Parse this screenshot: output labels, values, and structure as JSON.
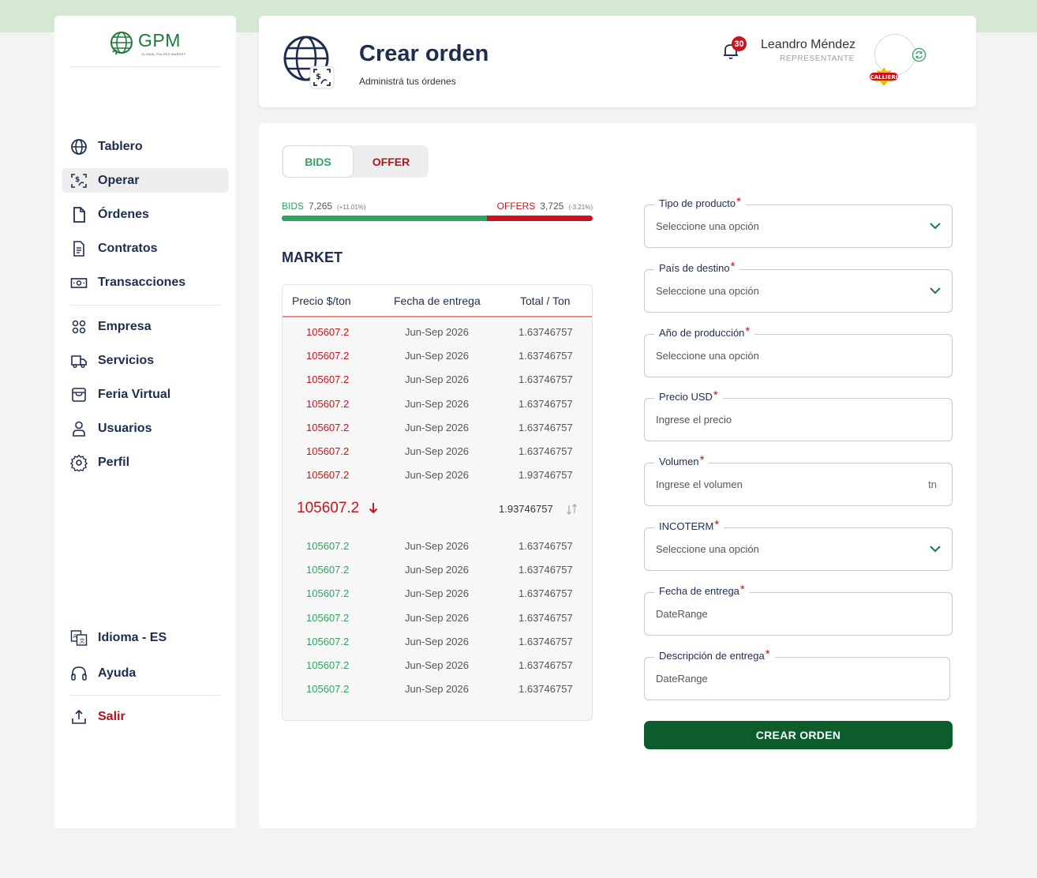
{
  "brand": {
    "logo_text": "GPM",
    "logo_sub": "GLOBAL PULSES MARKET"
  },
  "sidebar": {
    "items": [
      {
        "label": "Tablero"
      },
      {
        "label": "Operar"
      },
      {
        "label": "Órdenes"
      },
      {
        "label": "Contratos"
      },
      {
        "label": "Transacciones"
      },
      {
        "label": "Empresa"
      },
      {
        "label": "Servicios"
      },
      {
        "label": "Feria Virtual"
      },
      {
        "label": "Usuarios"
      },
      {
        "label": "Perfil"
      }
    ],
    "bottom": [
      {
        "label": "Idioma - ES"
      },
      {
        "label": "Ayuda"
      },
      {
        "label": "Salir"
      }
    ]
  },
  "header": {
    "title": "Crear orden",
    "subtitle": "Administrá tus órdenes",
    "notifications": "30",
    "user_name": "Leandro Méndez",
    "user_role": "REPRESENTANTE",
    "brand_badge": "CALLIERI"
  },
  "tabs": {
    "bids": "BIDS",
    "offer": "OFFER"
  },
  "ratio": {
    "bids_label": "BIDS",
    "bids_value": "7,265",
    "bids_pct": "(+11.01%)",
    "offers_label": "OFFERS",
    "offers_value": "3,725",
    "offers_pct": "(-3.21%)",
    "bids_share": 0.66
  },
  "market": {
    "title": "MARKET",
    "columns": [
      "Precio $/ton",
      "Fecha de entrega",
      "Total / Ton"
    ],
    "offers": [
      {
        "price": "105607.2",
        "date": "Jun-Sep 2026",
        "total": "1.63746757"
      },
      {
        "price": "105607.2",
        "date": "Jun-Sep 2026",
        "total": "1.63746757"
      },
      {
        "price": "105607.2",
        "date": "Jun-Sep 2026",
        "total": "1.63746757"
      },
      {
        "price": "105607.2",
        "date": "Jun-Sep 2026",
        "total": "1.63746757"
      },
      {
        "price": "105607.2",
        "date": "Jun-Sep 2026",
        "total": "1.63746757"
      },
      {
        "price": "105607.2",
        "date": "Jun-Sep 2026",
        "total": "1.63746757"
      },
      {
        "price": "105607.2",
        "date": "Jun-Sep 2026",
        "total": "1.93746757"
      }
    ],
    "last_price": "105607.2",
    "last_total": "1.93746757",
    "bids": [
      {
        "price": "105607.2",
        "date": "Jun-Sep 2026",
        "total": "1.63746757"
      },
      {
        "price": "105607.2",
        "date": "Jun-Sep 2026",
        "total": "1.63746757"
      },
      {
        "price": "105607.2",
        "date": "Jun-Sep 2026",
        "total": "1.63746757"
      },
      {
        "price": "105607.2",
        "date": "Jun-Sep 2026",
        "total": "1.63746757"
      },
      {
        "price": "105607.2",
        "date": "Jun-Sep 2026",
        "total": "1.63746757"
      },
      {
        "price": "105607.2",
        "date": "Jun-Sep 2026",
        "total": "1.63746757"
      },
      {
        "price": "105607.2",
        "date": "Jun-Sep 2026",
        "total": "1.63746757"
      }
    ]
  },
  "form": {
    "fields": [
      {
        "label": "Tipo de producto",
        "placeholder": "Seleccione una opción"
      },
      {
        "label": "País de destino",
        "placeholder": "Seleccione una opción"
      },
      {
        "label": "Año de producción",
        "placeholder": "Seleccione una opción"
      },
      {
        "label": "Precio  USD",
        "placeholder": "Ingrese el precio"
      },
      {
        "label": "Volumen",
        "placeholder": "Ingrese el volumen",
        "unit": "tn"
      },
      {
        "label": "INCOTERM",
        "placeholder": "Seleccione una opción"
      },
      {
        "label": "Fecha de entrega",
        "placeholder": "DateRange"
      },
      {
        "label": "Descripción de entrega",
        "placeholder": "DateRange"
      }
    ],
    "required_mark": "*",
    "submit": "CREAR ORDEN"
  },
  "colors": {
    "green": "#2ea560",
    "red": "#c8141c",
    "dark_green": "#0d5c2b",
    "navy": "#1d2d4f"
  },
  "icons": [
    "globe-icon",
    "exchange-icon",
    "document-icon",
    "contract-icon",
    "cash-icon",
    "company-icon",
    "truck-icon",
    "store-icon",
    "user-icon",
    "gear-icon",
    "translate-icon",
    "headset-icon",
    "logout-icon",
    "bell-icon",
    "refresh-icon",
    "chevron-down-icon",
    "arrow-down-icon",
    "swap-icon"
  ]
}
